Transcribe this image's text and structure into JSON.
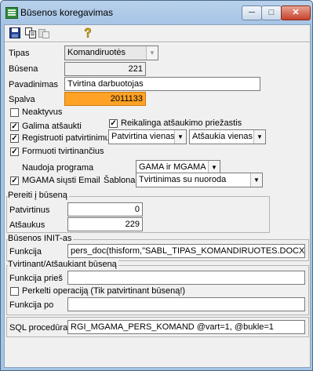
{
  "window": {
    "title": "Būsenos koregavimas",
    "min": "─",
    "max": "□",
    "close": "✕"
  },
  "toolbar": {
    "save_icon": "floppy-disk-icon",
    "copy_icon": "copy-icon",
    "paste_icon": "paste-icon",
    "help_icon": "help-icon"
  },
  "form": {
    "tipas": {
      "label": "Tipas",
      "value": "Komandiruotės"
    },
    "busena": {
      "label": "Būsena",
      "value": "221"
    },
    "pavadinimas": {
      "label": "Pavadinimas",
      "value": "Tvirtina darbuotojas"
    },
    "spalva": {
      "label": "Spalva",
      "value": "2011133",
      "color": "#ffa225"
    },
    "neaktyvus": {
      "label": "Neaktyvus",
      "checked": false
    },
    "galima_atsaukti": {
      "label": "Galima atšaukti",
      "checked": true
    },
    "reikalinga_priezastis": {
      "label": "Reikalinga atšaukimo priežastis",
      "checked": true
    },
    "registruoti": {
      "label": "Registruoti patvirtinimus",
      "checked": true
    },
    "patvirtina_combo": "Patvirtina vienas",
    "atsaukia_combo": "Atšaukia vienas",
    "formuoti": {
      "label": "Formuoti tvirtinančius",
      "checked": true
    },
    "naudoja_programa": {
      "label": "Naudoja programa",
      "value": "GAMA ir MGAMA"
    },
    "mgama": {
      "label": "MGAMA siųsti Email",
      "checked": true
    },
    "sablonas": {
      "label": "Šablonas",
      "value": "Tvirtinimas su nuoroda"
    }
  },
  "pereiti": {
    "title": "Pereiti į būseną",
    "patvirtinus": {
      "label": "Patvirtinus",
      "value": "0"
    },
    "atsaukus": {
      "label": "Atšaukus",
      "value": "229"
    }
  },
  "init": {
    "title": "Būsenos INIT-as",
    "funkcija": {
      "label": "Funkcija",
      "value": "pers_doc(thisform,\"SABL_TIPAS_KOMANDIRUOTES.DOCX\",.T.)"
    }
  },
  "tvirtinant": {
    "title": "Tvirtinant/Atšaukiant būseną",
    "pries": {
      "label": "Funkcija prieš",
      "value": ""
    },
    "perkelti": {
      "label": "Perkelti operaciją (Tik patvirtinant būseną!)",
      "checked": false
    },
    "po": {
      "label": "Funkcija po",
      "value": ""
    }
  },
  "sql": {
    "label": "SQL procedūra",
    "value": "RGI_MGAMA_PERS_KOMAND @vart=1,  @bukle=1"
  }
}
